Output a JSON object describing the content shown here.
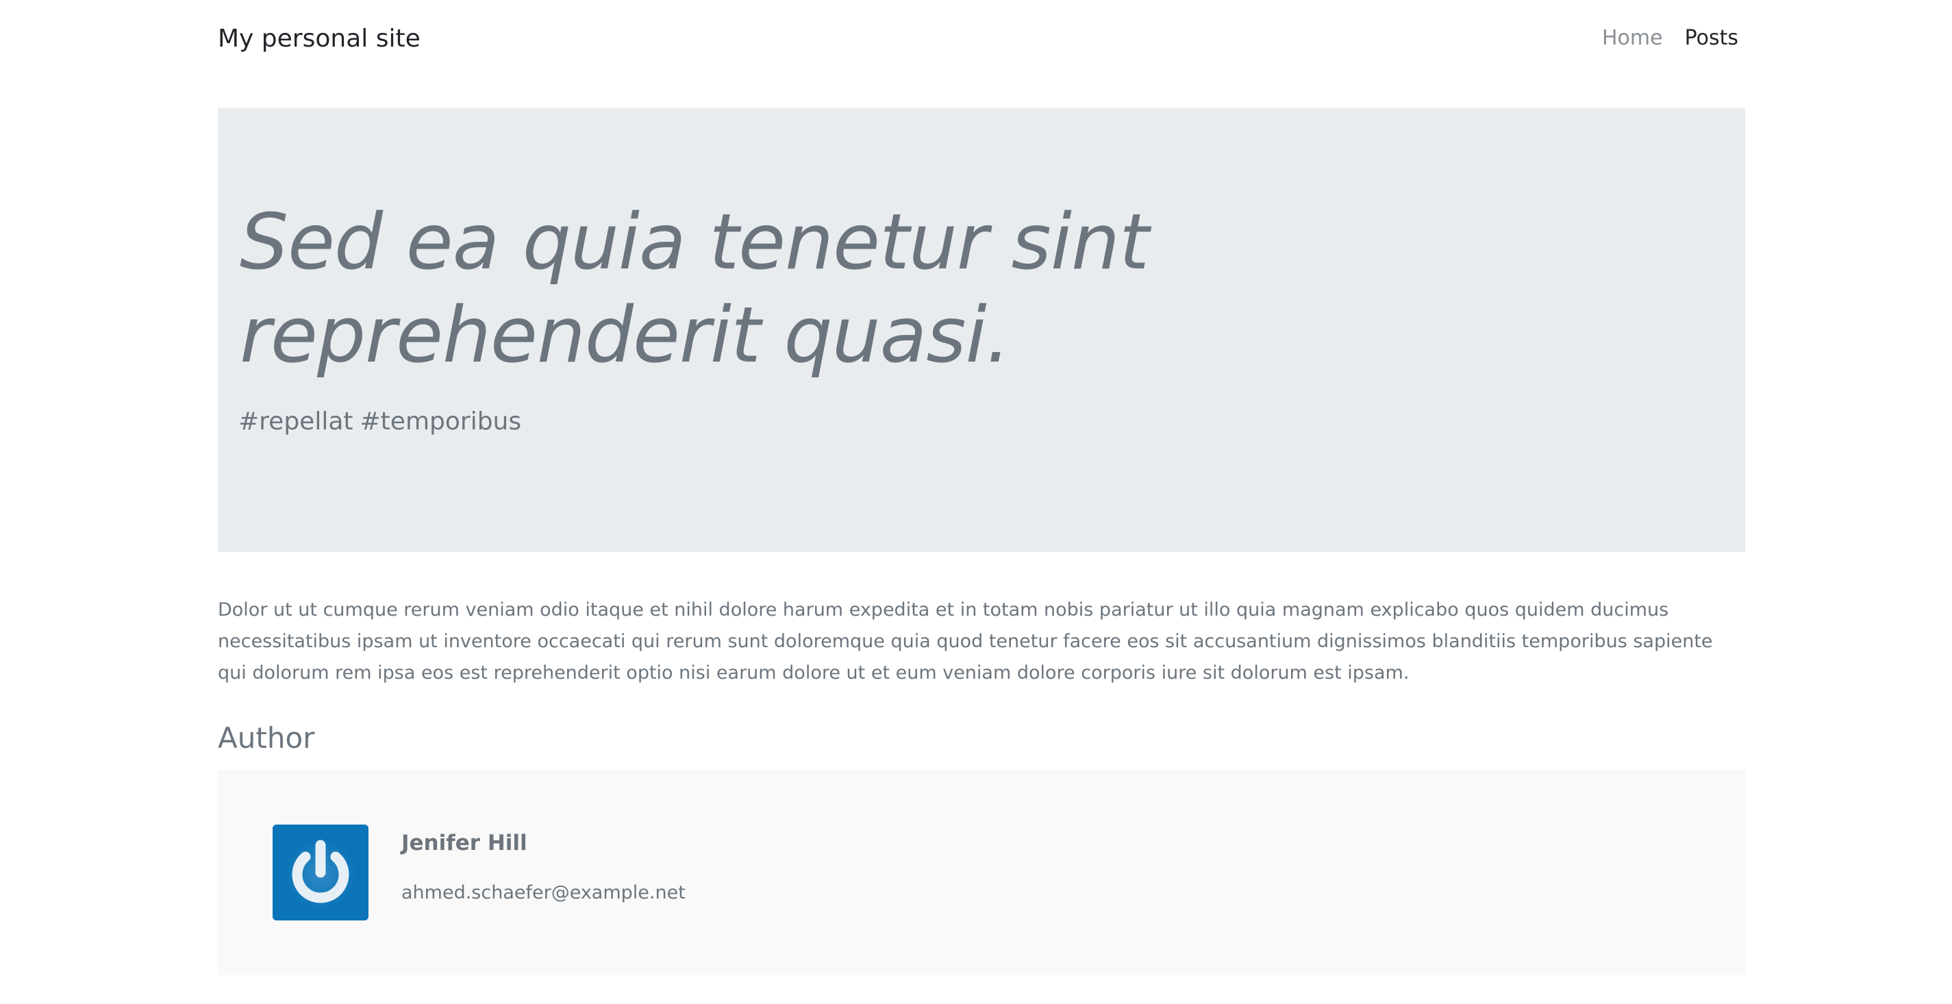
{
  "header": {
    "brand": "My personal site",
    "nav": [
      {
        "label": "Home"
      },
      {
        "label": "Posts"
      }
    ]
  },
  "post": {
    "title": "Sed ea quia tenetur sint reprehenderit quasi.",
    "tags": [
      "#repellat",
      "#temporibus"
    ],
    "body": "Dolor ut ut cumque rerum veniam odio itaque et nihil dolore harum expedita et in totam nobis pariatur ut illo quia magnam explicabo quos quidem ducimus necessitatibus ipsam ut inventore occaecati qui rerum sunt doloremque quia quod tenetur facere eos sit accusantium dignissimos blanditiis temporibus sapiente qui dolorum rem ipsa eos est reprehenderit optio nisi earum dolore ut et eum veniam dolore corporis iure sit dolorum est ipsam."
  },
  "author": {
    "heading": "Author",
    "name": "Jenifer Hill",
    "email": "ahmed.schaefer@example.net",
    "avatar_icon": "power-icon",
    "avatar_color": "#0b74b8"
  },
  "colors": {
    "hero_background": "#e9ecef",
    "author_card_background": "#f9f9f9",
    "text_muted": "#6c757d",
    "text_dark": "#212529"
  }
}
